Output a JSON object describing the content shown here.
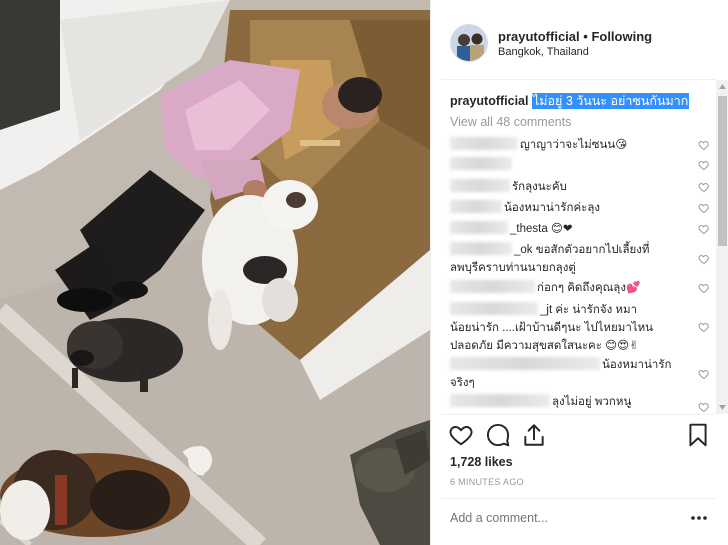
{
  "post": {
    "username": "prayutofficial",
    "separator": "•",
    "follow_label": "Following",
    "location": "Bangkok, Thailand",
    "caption_user": "prayutofficial",
    "caption_text": "ไม่อยู่ 3 วันนะ อย่าซนกันมาก",
    "view_all": "View all 48 comments",
    "likes": "1,728 likes",
    "time": "6 MINUTES AGO",
    "add_comment_placeholder": "Add a comment..."
  },
  "comments": [
    {
      "visible": "ญาญาว่าจะไม่ซนน😘",
      "line2": ""
    },
    {
      "visible": "",
      "line2": ""
    },
    {
      "visible": "รักลุงนะคับ",
      "line2": ""
    },
    {
      "visible": "น้องหมาน่ารักค่ะลุง",
      "line2": ""
    },
    {
      "visible": "_thesta 😊❤",
      "line2": ""
    },
    {
      "visible": "_ok ขอสักตัวอยากไปเลี้ยงที่",
      "line2": "ลพบุรีคราบท่านนายกลุงตู่"
    },
    {
      "visible": "ก่อกๆ คิดถึงคุณลุง💕",
      "line2": ""
    },
    {
      "visible": "_jt ค่ะ น่ารักจัง หมา",
      "line2": "น้อยน่ารัก ....เฝ้าบ้านดีๆนะ ไปไหยมาไหน",
      "line3": "ปลอดภัย มีความสุขสดใสนะคะ 😊😍✌"
    },
    {
      "visible": "น้องหมาน่ารัก",
      "line2": "จริงๆ"
    },
    {
      "visible": "ลุงไม่อยู่ พวกหนู",
      "line2": ""
    }
  ],
  "icons": {
    "like": "heart-outline-icon",
    "comment": "speech-bubble-icon",
    "share": "share-upload-icon",
    "save": "bookmark-icon",
    "more": "more-dots-icon",
    "comment_like": "small-heart-icon"
  },
  "colors": {
    "text": "#262626",
    "muted": "#999999",
    "highlight": "#3390ff",
    "border": "#efefef"
  }
}
